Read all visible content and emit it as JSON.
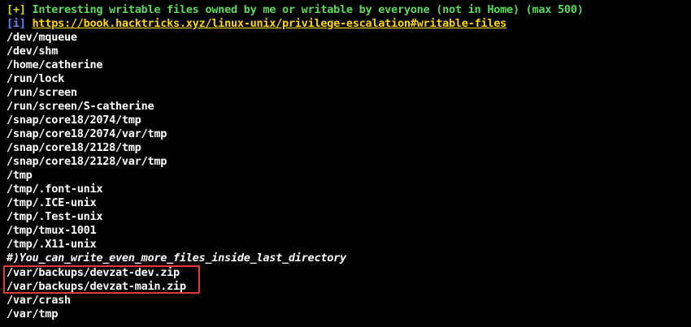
{
  "header": {
    "prefix": "[+]",
    "title": "Interesting writable files owned by me or writable by everyone (not in Home) (max 500)"
  },
  "info": {
    "prefix": "[i]",
    "link": "https://book.hacktricks.xyz/linux-unix/privilege-escalation#writable-files"
  },
  "paths_before": [
    "/dev/mqueue",
    "/dev/shm",
    "/home/catherine",
    "/run/lock",
    "/run/screen",
    "/run/screen/S-catherine",
    "/snap/core18/2074/tmp",
    "/snap/core18/2074/var/tmp",
    "/snap/core18/2128/tmp",
    "/snap/core18/2128/var/tmp",
    "/tmp",
    "/tmp/.font-unix",
    "/tmp/.ICE-unix",
    "/tmp/.Test-unix",
    "/tmp/tmux-1001",
    "/tmp/.X11-unix"
  ],
  "hint": "#)You_can_write_even_more_files_inside_last_directory",
  "highlighted_paths": [
    "/var/backups/devzat-dev.zip",
    "/var/backups/devzat-main.zip"
  ],
  "paths_after": [
    "/var/crash",
    "/var/tmp"
  ],
  "colors": {
    "background": "#000000",
    "text": "#ffffff",
    "header_prefix": "#d7d700",
    "header_text": "#5fd75f",
    "info_prefix": "#5f87ff",
    "link": "#ffd700",
    "highlight_border": "#e53935"
  }
}
